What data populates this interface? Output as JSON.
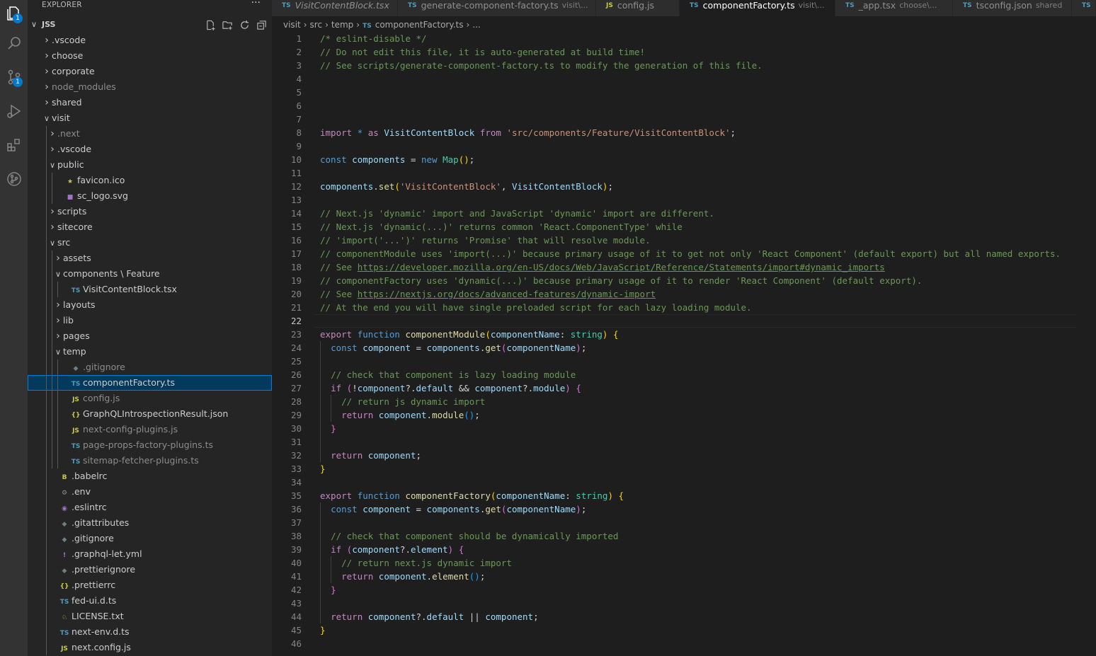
{
  "sidebar": {
    "title": "EXPLORER",
    "more": "···",
    "root": "JSS",
    "tree": [
      {
        "label": ".vscode",
        "depth": 0,
        "type": "folder",
        "open": false
      },
      {
        "label": "choose",
        "depth": 0,
        "type": "folder",
        "open": false
      },
      {
        "label": "corporate",
        "depth": 0,
        "type": "folder",
        "open": false
      },
      {
        "label": "node_modules",
        "depth": 0,
        "type": "folder",
        "open": false,
        "dim": true
      },
      {
        "label": "shared",
        "depth": 0,
        "type": "folder",
        "open": false
      },
      {
        "label": "visit",
        "depth": 0,
        "type": "folder",
        "open": true
      },
      {
        "label": ".next",
        "depth": 1,
        "type": "folder",
        "open": false,
        "dim": true
      },
      {
        "label": ".vscode",
        "depth": 1,
        "type": "folder",
        "open": false
      },
      {
        "label": "public",
        "depth": 1,
        "type": "folder",
        "open": true
      },
      {
        "label": "favicon.ico",
        "depth": 2,
        "type": "file",
        "icon": "star"
      },
      {
        "label": "sc_logo.svg",
        "depth": 2,
        "type": "file",
        "icon": "svg"
      },
      {
        "label": "scripts",
        "depth": 1,
        "type": "folder",
        "open": false
      },
      {
        "label": "sitecore",
        "depth": 1,
        "type": "folder",
        "open": false
      },
      {
        "label": "src",
        "depth": 1,
        "type": "folder",
        "open": true
      },
      {
        "label": "assets",
        "depth": 2,
        "type": "folder",
        "open": false
      },
      {
        "label": "components \\ Feature",
        "depth": 2,
        "type": "folder",
        "open": true
      },
      {
        "label": "VisitContentBlock.tsx",
        "depth": 3,
        "type": "file",
        "icon": "ts"
      },
      {
        "label": "layouts",
        "depth": 2,
        "type": "folder",
        "open": false
      },
      {
        "label": "lib",
        "depth": 2,
        "type": "folder",
        "open": false
      },
      {
        "label": "pages",
        "depth": 2,
        "type": "folder",
        "open": false
      },
      {
        "label": "temp",
        "depth": 2,
        "type": "folder",
        "open": true
      },
      {
        "label": ".gitignore",
        "depth": 3,
        "type": "file",
        "icon": "git",
        "dim": true
      },
      {
        "label": "componentFactory.ts",
        "depth": 3,
        "type": "file",
        "icon": "ts",
        "selected": true
      },
      {
        "label": "config.js",
        "depth": 3,
        "type": "file",
        "icon": "js",
        "dim": true
      },
      {
        "label": "GraphQLIntrospectionResult.json",
        "depth": 3,
        "type": "file",
        "icon": "json"
      },
      {
        "label": "next-config-plugins.js",
        "depth": 3,
        "type": "file",
        "icon": "js",
        "dim": true
      },
      {
        "label": "page-props-factory-plugins.ts",
        "depth": 3,
        "type": "file",
        "icon": "ts",
        "dim": true
      },
      {
        "label": "sitemap-fetcher-plugins.ts",
        "depth": 3,
        "type": "file",
        "icon": "ts",
        "dim": true
      },
      {
        "label": ".babelrc",
        "depth": 1,
        "type": "file",
        "icon": "babel"
      },
      {
        "label": ".env",
        "depth": 1,
        "type": "file",
        "icon": "gear"
      },
      {
        "label": ".eslintrc",
        "depth": 1,
        "type": "file",
        "icon": "eslint"
      },
      {
        "label": ".gitattributes",
        "depth": 1,
        "type": "file",
        "icon": "git"
      },
      {
        "label": ".gitignore",
        "depth": 1,
        "type": "file",
        "icon": "git"
      },
      {
        "label": ".graphql-let.yml",
        "depth": 1,
        "type": "file",
        "icon": "yml"
      },
      {
        "label": ".prettierignore",
        "depth": 1,
        "type": "file",
        "icon": "git"
      },
      {
        "label": ".prettierrc",
        "depth": 1,
        "type": "file",
        "icon": "json"
      },
      {
        "label": "fed-ui.d.ts",
        "depth": 1,
        "type": "file",
        "icon": "ts"
      },
      {
        "label": "LICENSE.txt",
        "depth": 1,
        "type": "file",
        "icon": "license"
      },
      {
        "label": "next-env.d.ts",
        "depth": 1,
        "type": "file",
        "icon": "ts"
      },
      {
        "label": "next.config.js",
        "depth": 1,
        "type": "file",
        "icon": "js"
      }
    ]
  },
  "tabs": [
    {
      "icon": "TS",
      "label": "VisitContentBlock.tsx",
      "hint": "",
      "italic": true,
      "active": false
    },
    {
      "icon": "TS",
      "label": "generate-component-factory.ts",
      "hint": "visit\\...",
      "active": false
    },
    {
      "icon": "JS",
      "label": "config.js",
      "hint": "",
      "active": false
    },
    {
      "icon": "TS",
      "label": "componentFactory.ts",
      "hint": "visit\\...",
      "active": true,
      "dirty": true
    },
    {
      "icon": "TS",
      "label": "_app.tsx",
      "hint": "choose\\...",
      "active": false
    },
    {
      "icon": "TS",
      "label": "tsconfig.json",
      "hint": "shared",
      "active": false
    },
    {
      "icon": "TS",
      "label": "",
      "hint": "",
      "active": false
    }
  ],
  "breadcrumb": {
    "parts": [
      "visit",
      "src",
      "temp"
    ],
    "file_icon": "TS",
    "file": "componentFactory.ts",
    "more": "..."
  },
  "editor": {
    "current_line": 22,
    "lines": [
      [
        [
          "c-com",
          "/* eslint-disable */"
        ]
      ],
      [
        [
          "c-com",
          "// Do not edit this file, it is auto-generated at build time!"
        ]
      ],
      [
        [
          "c-com",
          "// See scripts/generate-component-factory.ts to modify the generation of this file."
        ]
      ],
      [],
      [],
      [],
      [],
      [
        [
          "c-ctl",
          "import"
        ],
        [
          "c-punc",
          " "
        ],
        [
          "c-kw",
          "*"
        ],
        [
          "c-punc",
          " "
        ],
        [
          "c-ctl",
          "as"
        ],
        [
          "c-punc",
          " "
        ],
        [
          "c-var",
          "VisitContentBlock"
        ],
        [
          "c-punc",
          " "
        ],
        [
          "c-ctl",
          "from"
        ],
        [
          "c-punc",
          " "
        ],
        [
          "c-str",
          "'src/components/Feature/VisitContentBlock'"
        ],
        [
          "c-punc",
          ";"
        ]
      ],
      [],
      [
        [
          "c-kw",
          "const"
        ],
        [
          "c-punc",
          " "
        ],
        [
          "c-var",
          "components"
        ],
        [
          "c-punc",
          " = "
        ],
        [
          "c-kw",
          "new"
        ],
        [
          "c-punc",
          " "
        ],
        [
          "c-cls",
          "Map"
        ],
        [
          "c-b1",
          "()"
        ],
        [
          "c-punc",
          ";"
        ]
      ],
      [],
      [
        [
          "c-var",
          "components"
        ],
        [
          "c-punc",
          "."
        ],
        [
          "c-fn",
          "set"
        ],
        [
          "c-b1",
          "("
        ],
        [
          "c-str",
          "'VisitContentBlock'"
        ],
        [
          "c-punc",
          ", "
        ],
        [
          "c-var",
          "VisitContentBlock"
        ],
        [
          "c-b1",
          ")"
        ],
        [
          "c-punc",
          ";"
        ]
      ],
      [],
      [
        [
          "c-com",
          "// Next.js 'dynamic' import and JavaScript 'dynamic' import are different."
        ]
      ],
      [
        [
          "c-com",
          "// Next.js 'dynamic(...)' returns common 'React.ComponentType' while"
        ]
      ],
      [
        [
          "c-com",
          "// 'import('...')' returns 'Promise' that will resolve module."
        ]
      ],
      [
        [
          "c-com",
          "// componentModule uses 'import(...)' because primary usage of it to get not only 'React Component' (default export) but all named exports."
        ]
      ],
      [
        [
          "c-com",
          "// See "
        ],
        [
          "c-url",
          "https://developer.mozilla.org/en-US/docs/Web/JavaScript/Reference/Statements/import#dynamic_imports"
        ]
      ],
      [
        [
          "c-com",
          "// componentFactory uses 'dynamic(...)' because primary usage of it to render 'React Component' (default export)."
        ]
      ],
      [
        [
          "c-com",
          "// See "
        ],
        [
          "c-url",
          "https://nextjs.org/docs/advanced-features/dynamic-import"
        ]
      ],
      [
        [
          "c-com",
          "// At the end you will have single preloaded script for each lazy loading module."
        ]
      ],
      [],
      [
        [
          "c-ctl",
          "export"
        ],
        [
          "c-punc",
          " "
        ],
        [
          "c-kw",
          "function"
        ],
        [
          "c-punc",
          " "
        ],
        [
          "c-fn",
          "componentModule"
        ],
        [
          "c-b1",
          "("
        ],
        [
          "c-var",
          "componentName"
        ],
        [
          "c-punc",
          ": "
        ],
        [
          "c-cls",
          "string"
        ],
        [
          "c-b1",
          ")"
        ],
        [
          "c-punc",
          " "
        ],
        [
          "c-b1",
          "{"
        ]
      ],
      [
        [
          "c-punc",
          "  "
        ],
        [
          "c-kw",
          "const"
        ],
        [
          "c-punc",
          " "
        ],
        [
          "c-var",
          "component"
        ],
        [
          "c-punc",
          " = "
        ],
        [
          "c-var",
          "components"
        ],
        [
          "c-punc",
          "."
        ],
        [
          "c-fn",
          "get"
        ],
        [
          "c-b2",
          "("
        ],
        [
          "c-var",
          "componentName"
        ],
        [
          "c-b2",
          ")"
        ],
        [
          "c-punc",
          ";"
        ]
      ],
      [],
      [
        [
          "c-punc",
          "  "
        ],
        [
          "c-com",
          "// check that component is lazy loading module"
        ]
      ],
      [
        [
          "c-punc",
          "  "
        ],
        [
          "c-ctl",
          "if"
        ],
        [
          "c-punc",
          " "
        ],
        [
          "c-b2",
          "("
        ],
        [
          "c-punc",
          "!"
        ],
        [
          "c-var",
          "component"
        ],
        [
          "c-punc",
          "?."
        ],
        [
          "c-var",
          "default"
        ],
        [
          "c-punc",
          " && "
        ],
        [
          "c-var",
          "component"
        ],
        [
          "c-punc",
          "?."
        ],
        [
          "c-var",
          "module"
        ],
        [
          "c-b2",
          ")"
        ],
        [
          "c-punc",
          " "
        ],
        [
          "c-b2",
          "{"
        ]
      ],
      [
        [
          "c-punc",
          "    "
        ],
        [
          "c-com",
          "// return js dynamic import"
        ]
      ],
      [
        [
          "c-punc",
          "    "
        ],
        [
          "c-ctl",
          "return"
        ],
        [
          "c-punc",
          " "
        ],
        [
          "c-var",
          "component"
        ],
        [
          "c-punc",
          "."
        ],
        [
          "c-fn",
          "module"
        ],
        [
          "c-b3",
          "()"
        ],
        [
          "c-punc",
          ";"
        ]
      ],
      [
        [
          "c-punc",
          "  "
        ],
        [
          "c-b2",
          "}"
        ]
      ],
      [],
      [
        [
          "c-punc",
          "  "
        ],
        [
          "c-ctl",
          "return"
        ],
        [
          "c-punc",
          " "
        ],
        [
          "c-var",
          "component"
        ],
        [
          "c-punc",
          ";"
        ]
      ],
      [
        [
          "c-b1",
          "}"
        ]
      ],
      [],
      [
        [
          "c-ctl",
          "export"
        ],
        [
          "c-punc",
          " "
        ],
        [
          "c-kw",
          "function"
        ],
        [
          "c-punc",
          " "
        ],
        [
          "c-fn",
          "componentFactory"
        ],
        [
          "c-b1",
          "("
        ],
        [
          "c-var",
          "componentName"
        ],
        [
          "c-punc",
          ": "
        ],
        [
          "c-cls",
          "string"
        ],
        [
          "c-b1",
          ")"
        ],
        [
          "c-punc",
          " "
        ],
        [
          "c-b1",
          "{"
        ]
      ],
      [
        [
          "c-punc",
          "  "
        ],
        [
          "c-kw",
          "const"
        ],
        [
          "c-punc",
          " "
        ],
        [
          "c-var",
          "component"
        ],
        [
          "c-punc",
          " = "
        ],
        [
          "c-var",
          "components"
        ],
        [
          "c-punc",
          "."
        ],
        [
          "c-fn",
          "get"
        ],
        [
          "c-b2",
          "("
        ],
        [
          "c-var",
          "componentName"
        ],
        [
          "c-b2",
          ")"
        ],
        [
          "c-punc",
          ";"
        ]
      ],
      [],
      [
        [
          "c-punc",
          "  "
        ],
        [
          "c-com",
          "// check that component should be dynamically imported"
        ]
      ],
      [
        [
          "c-punc",
          "  "
        ],
        [
          "c-ctl",
          "if"
        ],
        [
          "c-punc",
          " "
        ],
        [
          "c-b2",
          "("
        ],
        [
          "c-var",
          "component"
        ],
        [
          "c-punc",
          "?."
        ],
        [
          "c-var",
          "element"
        ],
        [
          "c-b2",
          ")"
        ],
        [
          "c-punc",
          " "
        ],
        [
          "c-b2",
          "{"
        ]
      ],
      [
        [
          "c-punc",
          "    "
        ],
        [
          "c-com",
          "// return next.js dynamic import"
        ]
      ],
      [
        [
          "c-punc",
          "    "
        ],
        [
          "c-ctl",
          "return"
        ],
        [
          "c-punc",
          " "
        ],
        [
          "c-var",
          "component"
        ],
        [
          "c-punc",
          "."
        ],
        [
          "c-fn",
          "element"
        ],
        [
          "c-b3",
          "()"
        ],
        [
          "c-punc",
          ";"
        ]
      ],
      [
        [
          "c-punc",
          "  "
        ],
        [
          "c-b2",
          "}"
        ]
      ],
      [],
      [
        [
          "c-punc",
          "  "
        ],
        [
          "c-ctl",
          "return"
        ],
        [
          "c-punc",
          " "
        ],
        [
          "c-var",
          "component"
        ],
        [
          "c-punc",
          "?."
        ],
        [
          "c-var",
          "default"
        ],
        [
          "c-punc",
          " || "
        ],
        [
          "c-var",
          "component"
        ],
        [
          "c-punc",
          ";"
        ]
      ],
      [
        [
          "c-b1",
          "}"
        ]
      ],
      []
    ]
  },
  "activity": {
    "items": [
      {
        "name": "explorer-icon",
        "badge": "1"
      },
      {
        "name": "search-icon",
        "badge": ""
      },
      {
        "name": "source-control-icon",
        "badge": "1"
      },
      {
        "name": "run-debug-icon",
        "badge": ""
      },
      {
        "name": "extensions-icon",
        "badge": ""
      },
      {
        "name": "git-graph-icon",
        "badge": ""
      }
    ]
  }
}
